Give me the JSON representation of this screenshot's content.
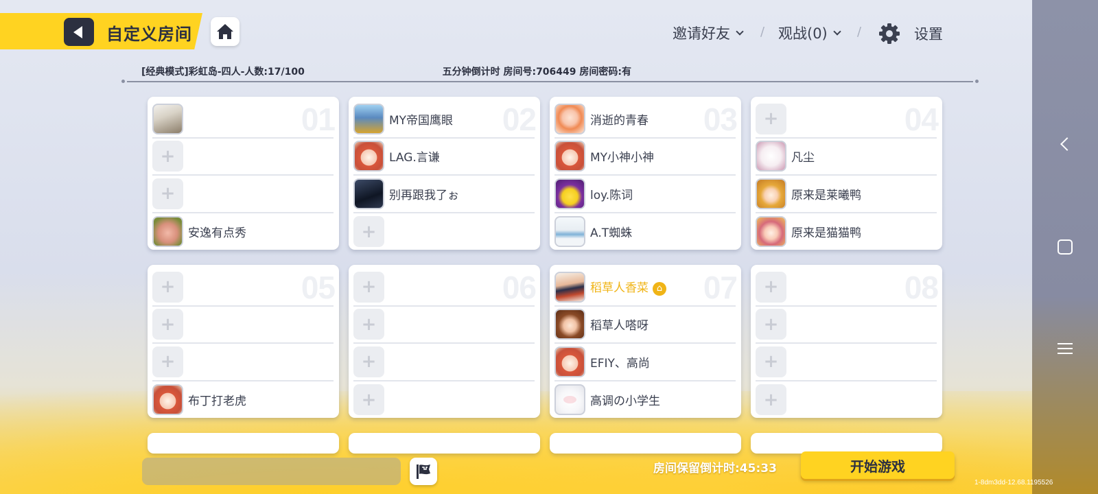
{
  "header": {
    "title": "自定义房间",
    "invite_label": "邀请好友",
    "spectate_label": "观战(0)",
    "settings_label": "设置"
  },
  "room": {
    "mode_info": "[经典模式]彩虹岛-四人-人数:17/100",
    "room_info": "五分钟倒计时 房间号:706449 房间密码:有"
  },
  "teams": [
    {
      "num": "01",
      "slots": [
        {
          "name": "",
          "filled": true,
          "avatar": "dog"
        },
        {
          "name": "",
          "filled": false
        },
        {
          "name": "",
          "filled": false
        },
        {
          "name": "安逸有点秀",
          "filled": true,
          "avatar": "pig"
        }
      ]
    },
    {
      "num": "02",
      "slots": [
        {
          "name": "MY帝国鹰眼",
          "filled": true,
          "avatar": "eagle"
        },
        {
          "name": "LAG.言谦",
          "filled": true,
          "avatar": "bear"
        },
        {
          "name": "别再跟我了ぉ",
          "filled": true,
          "avatar": "dark"
        },
        {
          "name": "",
          "filled": false
        }
      ]
    },
    {
      "num": "03",
      "slots": [
        {
          "name": "消逝的青春",
          "filled": true,
          "avatar": "girl"
        },
        {
          "name": "MY小神小神",
          "filled": true,
          "avatar": "bear"
        },
        {
          "name": "loy.陈词",
          "filled": true,
          "avatar": "purple"
        },
        {
          "name": "A.T蜘蛛",
          "filled": true,
          "avatar": "shark"
        }
      ]
    },
    {
      "num": "04",
      "slots": [
        {
          "name": "",
          "filled": false
        },
        {
          "name": "凡尘",
          "filled": true,
          "avatar": "white"
        },
        {
          "name": "原来是莱曦鸭",
          "filled": true,
          "avatar": "blonde"
        },
        {
          "name": "原来是猫猫鸭",
          "filled": true,
          "avatar": "pink"
        }
      ]
    },
    {
      "num": "05",
      "slots": [
        {
          "name": "",
          "filled": false
        },
        {
          "name": "",
          "filled": false
        },
        {
          "name": "",
          "filled": false
        },
        {
          "name": "布丁打老虎",
          "filled": true,
          "avatar": "bear"
        }
      ]
    },
    {
      "num": "06",
      "slots": [
        {
          "name": "",
          "filled": false
        },
        {
          "name": "",
          "filled": false
        },
        {
          "name": "",
          "filled": false
        },
        {
          "name": "",
          "filled": false
        }
      ]
    },
    {
      "num": "07",
      "slots": [
        {
          "name": "稻草人香菜",
          "filled": true,
          "avatar": "cap",
          "host": true
        },
        {
          "name": "稻草人嗒呀",
          "filled": true,
          "avatar": "brown"
        },
        {
          "name": "EFIY、高尚",
          "filled": true,
          "avatar": "bear"
        },
        {
          "name": "高调の小学生",
          "filled": true,
          "avatar": "cloud"
        }
      ]
    },
    {
      "num": "08",
      "slots": [
        {
          "name": "",
          "filled": false
        },
        {
          "name": "",
          "filled": false
        },
        {
          "name": "",
          "filled": false
        },
        {
          "name": "",
          "filled": false
        }
      ]
    }
  ],
  "bottom": {
    "chat_value": "",
    "countdown": "房间保留倒计时:45:33",
    "start_label": "开始游戏"
  },
  "version": "1-8dm3dd-12.68.1195526",
  "icons": {
    "back": "back-arrow-icon",
    "home": "home-icon",
    "settings": "gear-icon",
    "flag": "flag-icon",
    "add_slot": "plus-icon",
    "host": "crown-icon"
  },
  "colors": {
    "accent_yellow": "#ffd321",
    "host_name": "#f0b416",
    "dark_text": "#2c3040"
  }
}
